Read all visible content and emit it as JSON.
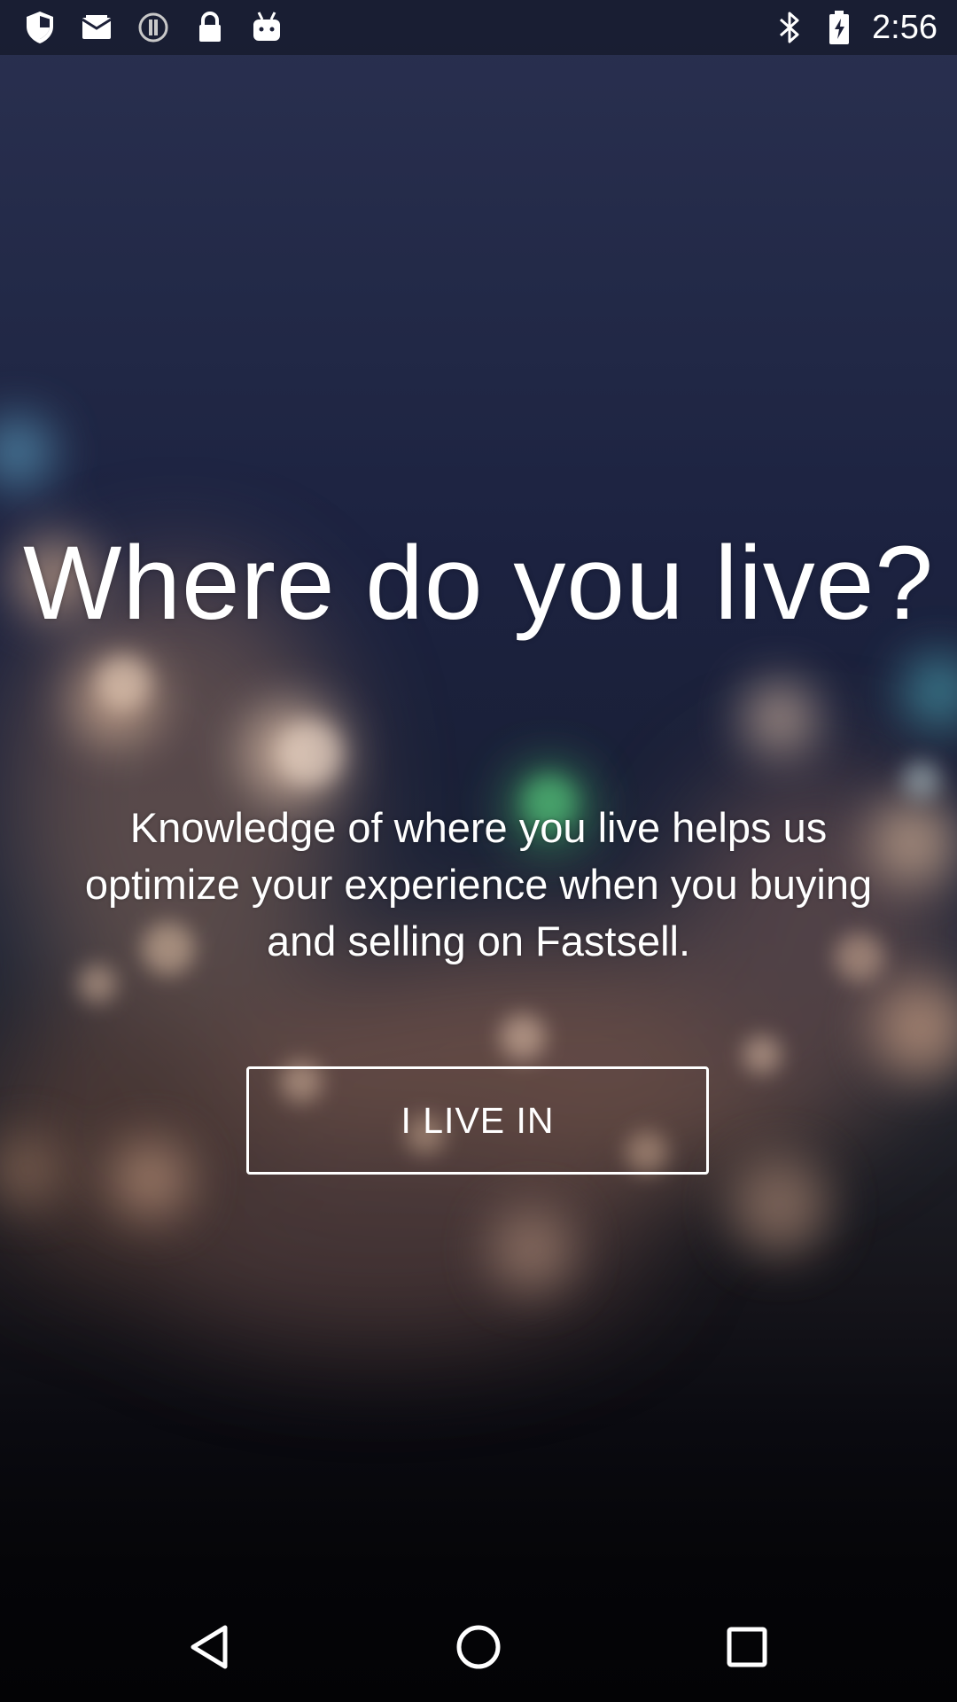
{
  "status_bar": {
    "time": "2:56",
    "left_icons": [
      "shield-icon",
      "email-icon",
      "info-icon",
      "lock-icon",
      "android-icon"
    ],
    "right_icons": [
      "bluetooth-icon",
      "battery-icon"
    ]
  },
  "main": {
    "title": "Where do you live?",
    "description": "Knowledge of where you live helps us optimize your experience when you buying and selling on Fastsell.",
    "button_label": "I LIVE IN"
  },
  "nav_bar": {
    "buttons": [
      "back-icon",
      "home-icon",
      "recents-icon"
    ]
  },
  "colors": {
    "text": "#ffffff",
    "background_top": "#2a3050",
    "background_bottom": "#030305"
  }
}
